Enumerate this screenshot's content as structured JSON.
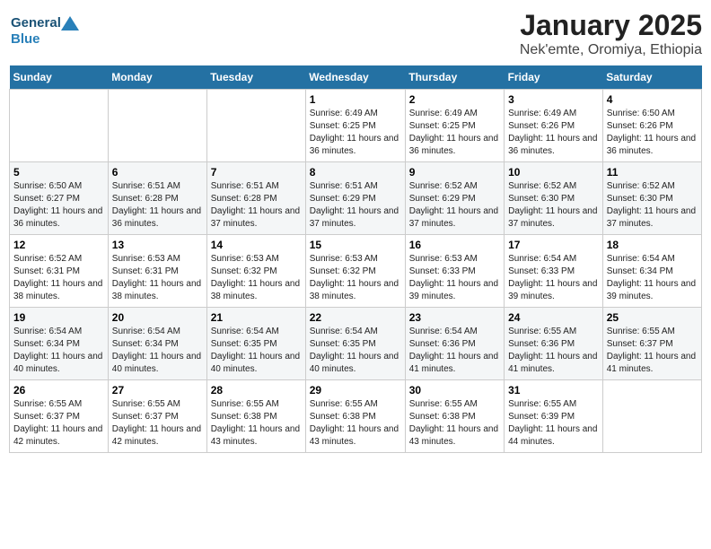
{
  "logo": {
    "general": "General",
    "blue": "Blue"
  },
  "header": {
    "title": "January 2025",
    "subtitle": "Nek'emte, Oromiya, Ethiopia"
  },
  "days_of_week": [
    "Sunday",
    "Monday",
    "Tuesday",
    "Wednesday",
    "Thursday",
    "Friday",
    "Saturday"
  ],
  "weeks": [
    [
      {
        "day": "",
        "info": ""
      },
      {
        "day": "",
        "info": ""
      },
      {
        "day": "",
        "info": ""
      },
      {
        "day": "1",
        "info": "Sunrise: 6:49 AM\nSunset: 6:25 PM\nDaylight: 11 hours and 36 minutes."
      },
      {
        "day": "2",
        "info": "Sunrise: 6:49 AM\nSunset: 6:25 PM\nDaylight: 11 hours and 36 minutes."
      },
      {
        "day": "3",
        "info": "Sunrise: 6:49 AM\nSunset: 6:26 PM\nDaylight: 11 hours and 36 minutes."
      },
      {
        "day": "4",
        "info": "Sunrise: 6:50 AM\nSunset: 6:26 PM\nDaylight: 11 hours and 36 minutes."
      }
    ],
    [
      {
        "day": "5",
        "info": "Sunrise: 6:50 AM\nSunset: 6:27 PM\nDaylight: 11 hours and 36 minutes."
      },
      {
        "day": "6",
        "info": "Sunrise: 6:51 AM\nSunset: 6:28 PM\nDaylight: 11 hours and 36 minutes."
      },
      {
        "day": "7",
        "info": "Sunrise: 6:51 AM\nSunset: 6:28 PM\nDaylight: 11 hours and 37 minutes."
      },
      {
        "day": "8",
        "info": "Sunrise: 6:51 AM\nSunset: 6:29 PM\nDaylight: 11 hours and 37 minutes."
      },
      {
        "day": "9",
        "info": "Sunrise: 6:52 AM\nSunset: 6:29 PM\nDaylight: 11 hours and 37 minutes."
      },
      {
        "day": "10",
        "info": "Sunrise: 6:52 AM\nSunset: 6:30 PM\nDaylight: 11 hours and 37 minutes."
      },
      {
        "day": "11",
        "info": "Sunrise: 6:52 AM\nSunset: 6:30 PM\nDaylight: 11 hours and 37 minutes."
      }
    ],
    [
      {
        "day": "12",
        "info": "Sunrise: 6:52 AM\nSunset: 6:31 PM\nDaylight: 11 hours and 38 minutes."
      },
      {
        "day": "13",
        "info": "Sunrise: 6:53 AM\nSunset: 6:31 PM\nDaylight: 11 hours and 38 minutes."
      },
      {
        "day": "14",
        "info": "Sunrise: 6:53 AM\nSunset: 6:32 PM\nDaylight: 11 hours and 38 minutes."
      },
      {
        "day": "15",
        "info": "Sunrise: 6:53 AM\nSunset: 6:32 PM\nDaylight: 11 hours and 38 minutes."
      },
      {
        "day": "16",
        "info": "Sunrise: 6:53 AM\nSunset: 6:33 PM\nDaylight: 11 hours and 39 minutes."
      },
      {
        "day": "17",
        "info": "Sunrise: 6:54 AM\nSunset: 6:33 PM\nDaylight: 11 hours and 39 minutes."
      },
      {
        "day": "18",
        "info": "Sunrise: 6:54 AM\nSunset: 6:34 PM\nDaylight: 11 hours and 39 minutes."
      }
    ],
    [
      {
        "day": "19",
        "info": "Sunrise: 6:54 AM\nSunset: 6:34 PM\nDaylight: 11 hours and 40 minutes."
      },
      {
        "day": "20",
        "info": "Sunrise: 6:54 AM\nSunset: 6:34 PM\nDaylight: 11 hours and 40 minutes."
      },
      {
        "day": "21",
        "info": "Sunrise: 6:54 AM\nSunset: 6:35 PM\nDaylight: 11 hours and 40 minutes."
      },
      {
        "day": "22",
        "info": "Sunrise: 6:54 AM\nSunset: 6:35 PM\nDaylight: 11 hours and 40 minutes."
      },
      {
        "day": "23",
        "info": "Sunrise: 6:54 AM\nSunset: 6:36 PM\nDaylight: 11 hours and 41 minutes."
      },
      {
        "day": "24",
        "info": "Sunrise: 6:55 AM\nSunset: 6:36 PM\nDaylight: 11 hours and 41 minutes."
      },
      {
        "day": "25",
        "info": "Sunrise: 6:55 AM\nSunset: 6:37 PM\nDaylight: 11 hours and 41 minutes."
      }
    ],
    [
      {
        "day": "26",
        "info": "Sunrise: 6:55 AM\nSunset: 6:37 PM\nDaylight: 11 hours and 42 minutes."
      },
      {
        "day": "27",
        "info": "Sunrise: 6:55 AM\nSunset: 6:37 PM\nDaylight: 11 hours and 42 minutes."
      },
      {
        "day": "28",
        "info": "Sunrise: 6:55 AM\nSunset: 6:38 PM\nDaylight: 11 hours and 43 minutes."
      },
      {
        "day": "29",
        "info": "Sunrise: 6:55 AM\nSunset: 6:38 PM\nDaylight: 11 hours and 43 minutes."
      },
      {
        "day": "30",
        "info": "Sunrise: 6:55 AM\nSunset: 6:38 PM\nDaylight: 11 hours and 43 minutes."
      },
      {
        "day": "31",
        "info": "Sunrise: 6:55 AM\nSunset: 6:39 PM\nDaylight: 11 hours and 44 minutes."
      },
      {
        "day": "",
        "info": ""
      }
    ]
  ]
}
